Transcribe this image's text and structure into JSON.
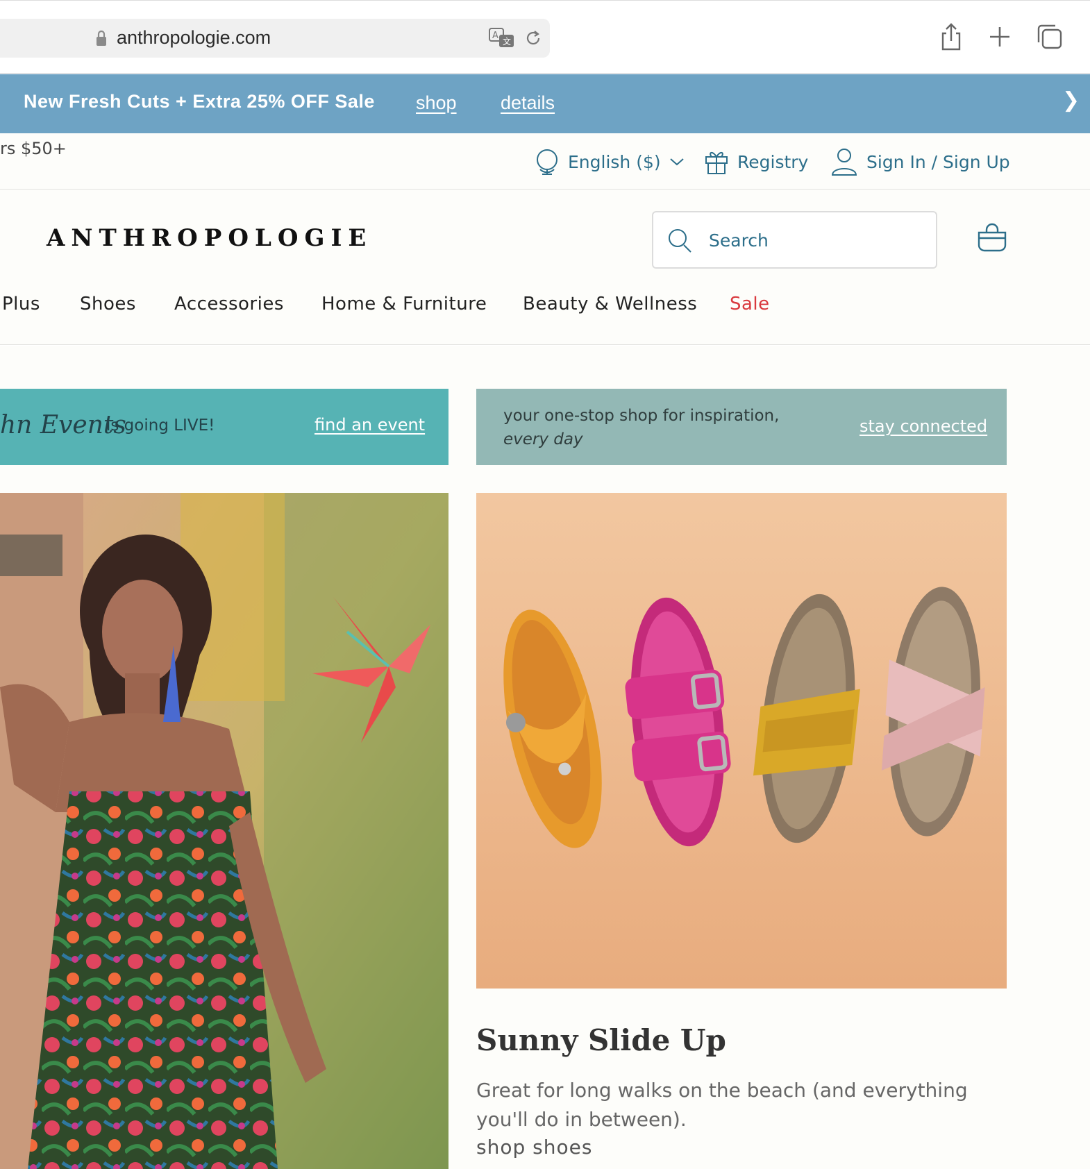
{
  "browser": {
    "url": "anthropologie.com"
  },
  "promo_bar": {
    "text": "New Fresh Cuts + Extra 25% OFF Sale",
    "shop_link": "shop",
    "details_link": "details",
    "next_glyph": "❯"
  },
  "utility": {
    "shipping_text": "rs $50+",
    "language": "English ($)",
    "registry": "Registry",
    "sign_in": "Sign In / Sign Up"
  },
  "header": {
    "logo": "ANTHROPOLOGIE",
    "search_placeholder": "Search"
  },
  "nav": {
    "items": [
      "Plus",
      "Shoes",
      "Accessories",
      "Home & Furniture",
      "Beauty & Wellness",
      "Sale"
    ]
  },
  "banners": {
    "left": {
      "script_text": "hn Events",
      "live_text": "is going LIVE!",
      "link": "find an event",
      "color": "#56b3b4"
    },
    "right": {
      "line1": "your one-stop shop for inspiration,",
      "line2": "every day",
      "link": "stay connected",
      "color": "#93b8b5"
    }
  },
  "feature": {
    "title": "Sunny Slide Up",
    "description": "Great for long walks on the beach (and everything you'll do in between).",
    "cta": "shop shoes"
  },
  "colors": {
    "promo_bg": "#6ea3c4",
    "accent_teal": "#2c6e8a",
    "sale_red": "#d9393e"
  }
}
